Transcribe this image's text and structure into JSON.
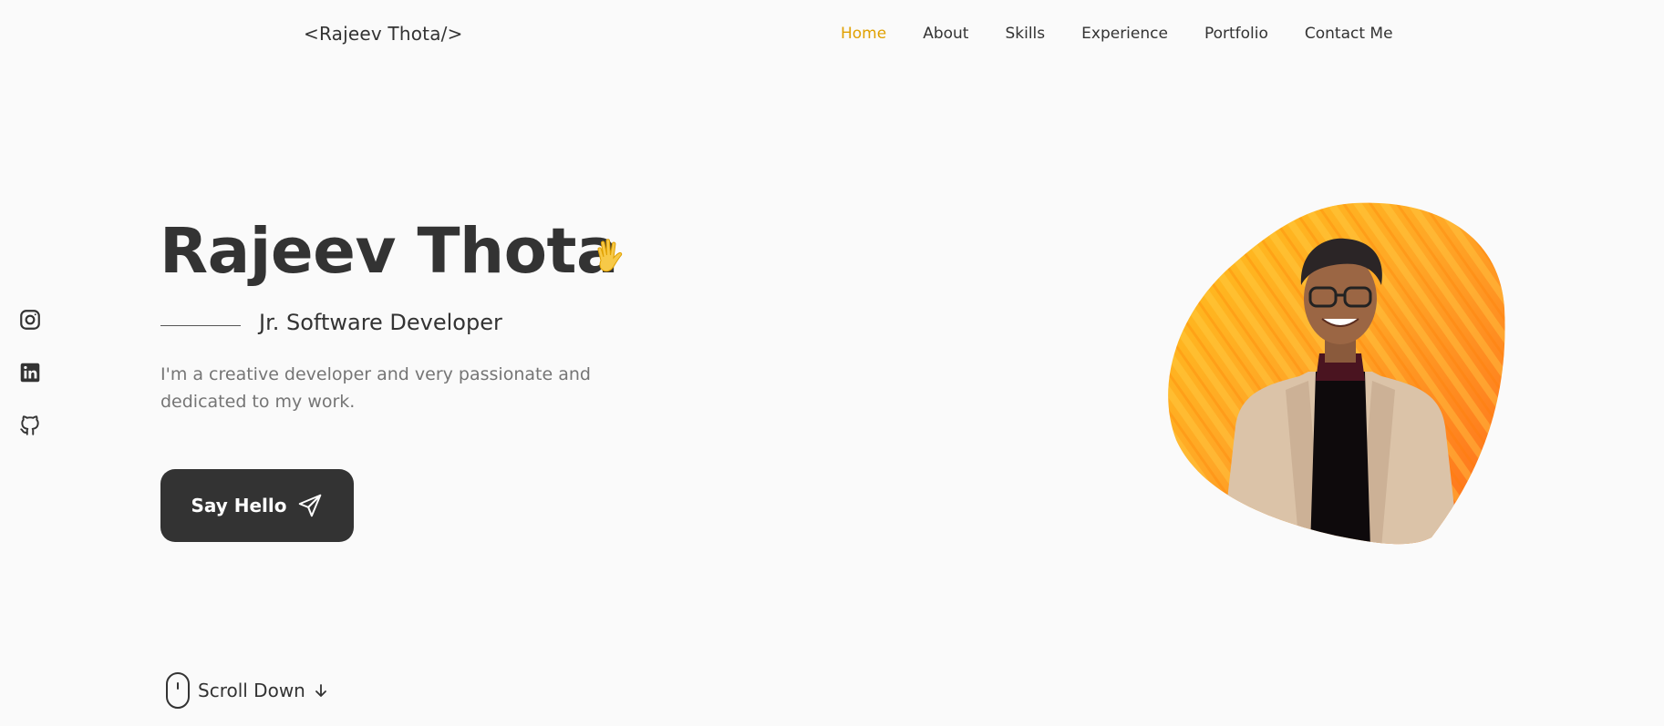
{
  "header": {
    "logo": "<Rajeev Thota/>",
    "nav": [
      {
        "label": "Home",
        "active": true
      },
      {
        "label": "About"
      },
      {
        "label": "Skills"
      },
      {
        "label": "Experience"
      },
      {
        "label": "Portfolio"
      },
      {
        "label": "Contact Me"
      }
    ]
  },
  "social": [
    "instagram-icon",
    "linkedin-icon",
    "github-icon"
  ],
  "hero": {
    "name": "Rajeev Thota",
    "role": "Jr. Software Developer",
    "description": "I'm a creative developer and very passionate and dedicated to my work.",
    "cta_label": "Say Hello",
    "scroll_label": "Scroll Down"
  },
  "colors": {
    "accent": "#e0a000",
    "text": "#333333",
    "muted": "#757575",
    "button_bg": "#333333",
    "background": "#fafafa"
  }
}
